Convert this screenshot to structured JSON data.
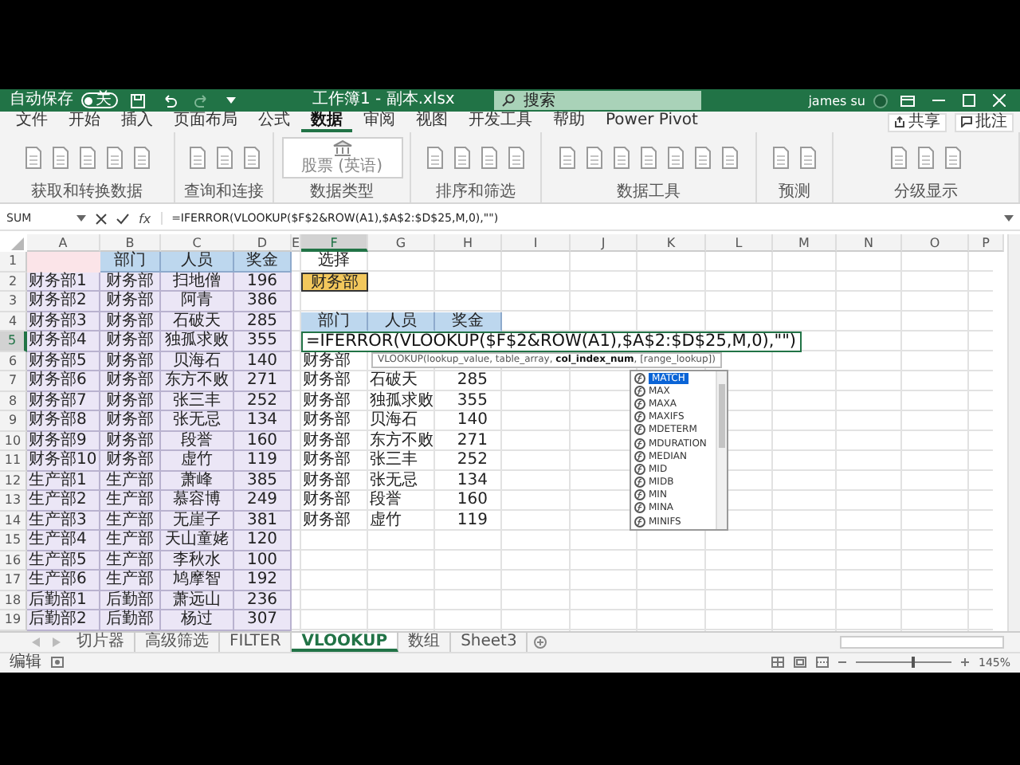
{
  "title_bar": {
    "autosave_label": "自动保存",
    "autosave_on": false,
    "autosave_state": "关",
    "file_title": "工作簿1 - 副本.xlsx",
    "search_placeholder": "搜索",
    "user": "james su"
  },
  "ribbon_tabs": [
    {
      "label": "文件",
      "selected": false
    },
    {
      "label": "开始",
      "selected": false
    },
    {
      "label": "插入",
      "selected": false
    },
    {
      "label": "页面布局",
      "selected": false
    },
    {
      "label": "公式",
      "selected": false
    },
    {
      "label": "数据",
      "selected": true
    },
    {
      "label": "审阅",
      "selected": false
    },
    {
      "label": "视图",
      "selected": false
    },
    {
      "label": "开发工具",
      "selected": false
    },
    {
      "label": "帮助",
      "selected": false
    },
    {
      "label": "Power Pivot",
      "selected": false
    }
  ],
  "ribbon_actions": [
    "共享",
    "批注"
  ],
  "ribbon_groups": [
    {
      "label": "获取和转换数据"
    },
    {
      "label": "查询和连接"
    },
    {
      "label": "数据类型",
      "gallery": "股票 (英语)"
    },
    {
      "label": "排序和筛选"
    },
    {
      "label": "数据工具"
    },
    {
      "label": "预测"
    },
    {
      "label": "分级显示"
    }
  ],
  "formula_bar": {
    "name_box": "SUM",
    "function_label": "fx",
    "formula": "=IFERROR(VLOOKUP($F$2&ROW(A1),$A$2:$D$25,M,0),\"\")"
  },
  "sheet": {
    "columns": [
      {
        "label": "A",
        "selected": false
      },
      {
        "label": "B",
        "selected": false
      },
      {
        "label": "C",
        "selected": false
      },
      {
        "label": "D",
        "selected": false
      },
      {
        "label": "E",
        "selected": false
      },
      {
        "label": "F",
        "selected": true
      },
      {
        "label": "G",
        "selected": false
      },
      {
        "label": "H",
        "selected": false
      },
      {
        "label": "I",
        "selected": false
      },
      {
        "label": "J",
        "selected": false
      },
      {
        "label": "K",
        "selected": false
      },
      {
        "label": "L",
        "selected": false
      },
      {
        "label": "M",
        "selected": false
      },
      {
        "label": "N",
        "selected": false
      },
      {
        "label": "O",
        "selected": false
      },
      {
        "label": "P",
        "selected": false
      }
    ],
    "row_numbers": [
      {
        "label": "1",
        "selected": false
      },
      {
        "label": "2",
        "selected": false
      },
      {
        "label": "3",
        "selected": false
      },
      {
        "label": "4",
        "selected": false
      },
      {
        "label": "5",
        "selected": true
      },
      {
        "label": "6",
        "selected": false
      },
      {
        "label": "7",
        "selected": false
      },
      {
        "label": "8",
        "selected": false
      },
      {
        "label": "9",
        "selected": false
      },
      {
        "label": "10",
        "selected": false
      },
      {
        "label": "11",
        "selected": false
      },
      {
        "label": "12",
        "selected": false
      },
      {
        "label": "13",
        "selected": false
      },
      {
        "label": "14",
        "selected": false
      },
      {
        "label": "15",
        "selected": false
      },
      {
        "label": "16",
        "selected": false
      },
      {
        "label": "17",
        "selected": false
      },
      {
        "label": "18",
        "selected": false
      },
      {
        "label": "19",
        "selected": false
      }
    ]
  },
  "source_table": {
    "headers": [
      "部门",
      "人员",
      "奖金"
    ],
    "rows": [
      [
        "财务部1",
        "财务部",
        "扫地僧",
        "196"
      ],
      [
        "财务部2",
        "财务部",
        "阿青",
        "386"
      ],
      [
        "财务部3",
        "财务部",
        "石破天",
        "285"
      ],
      [
        "财务部4",
        "财务部",
        "独孤求败",
        "355"
      ],
      [
        "财务部5",
        "财务部",
        "贝海石",
        "140"
      ],
      [
        "财务部6",
        "财务部",
        "东方不败",
        "271"
      ],
      [
        "财务部7",
        "财务部",
        "张三丰",
        "252"
      ],
      [
        "财务部8",
        "财务部",
        "张无忌",
        "134"
      ],
      [
        "财务部9",
        "财务部",
        "段誉",
        "160"
      ],
      [
        "财务部10",
        "财务部",
        "虚竹",
        "119"
      ],
      [
        "生产部1",
        "生产部",
        "萧峰",
        "385"
      ],
      [
        "生产部2",
        "生产部",
        "慕容博",
        "249"
      ],
      [
        "生产部3",
        "生产部",
        "无崖子",
        "381"
      ],
      [
        "生产部4",
        "生产部",
        "天山童姥",
        "120"
      ],
      [
        "生产部5",
        "生产部",
        "李秋水",
        "100"
      ],
      [
        "生产部6",
        "生产部",
        "鸠摩智",
        "192"
      ],
      [
        "后勤部1",
        "后勤部",
        "萧远山",
        "236"
      ],
      [
        "后勤部2",
        "后勤部",
        "杨过",
        "307"
      ]
    ]
  },
  "lookup": {
    "select_label": "选择",
    "select_value": "财务部",
    "headers": [
      "部门",
      "人员",
      "奖金"
    ],
    "rows": [
      [
        "财务部"
      ],
      [
        "财务部",
        "石破天",
        "285"
      ],
      [
        "财务部",
        "独孤求败",
        "355"
      ],
      [
        "财务部",
        "贝海石",
        "140"
      ],
      [
        "财务部",
        "东方不败",
        "271"
      ],
      [
        "财务部",
        "张三丰",
        "252"
      ],
      [
        "财务部",
        "张无忌",
        "134"
      ],
      [
        "财务部",
        "段誉",
        "160"
      ],
      [
        "财务部",
        "虚竹",
        "119"
      ]
    ]
  },
  "cell_editor": {
    "formula": "=IFERROR(VLOOKUP($F$2&ROW(A1),$A$2:$D$25,M,0),\"\")"
  },
  "tooltip": "VLOOKUP(lookup_value, table_array, **col_index_num**, [range_lookup])",
  "autocomplete": [
    {
      "label": "MATCH",
      "selected": true
    },
    {
      "label": "MAX",
      "selected": false
    },
    {
      "label": "MAXA",
      "selected": false
    },
    {
      "label": "MAXIFS",
      "selected": false
    },
    {
      "label": "MDETERM",
      "selected": false
    },
    {
      "label": "MDURATION",
      "selected": false
    },
    {
      "label": "MEDIAN",
      "selected": false
    },
    {
      "label": "MID",
      "selected": false
    },
    {
      "label": "MIDB",
      "selected": false
    },
    {
      "label": "MIN",
      "selected": false
    },
    {
      "label": "MINA",
      "selected": false
    },
    {
      "label": "MINIFS",
      "selected": false
    }
  ],
  "sheet_tabs": [
    {
      "label": "切片器",
      "selected": false
    },
    {
      "label": "高级筛选",
      "selected": false
    },
    {
      "label": "FILTER",
      "selected": false
    },
    {
      "label": "VLOOKUP",
      "selected": true
    },
    {
      "label": "数组",
      "selected": false
    },
    {
      "label": "Sheet3",
      "selected": false
    }
  ],
  "status_bar": {
    "mode": "编辑",
    "zoom": "145%",
    "zoom_slider": {
      "level": 0.6
    }
  }
}
